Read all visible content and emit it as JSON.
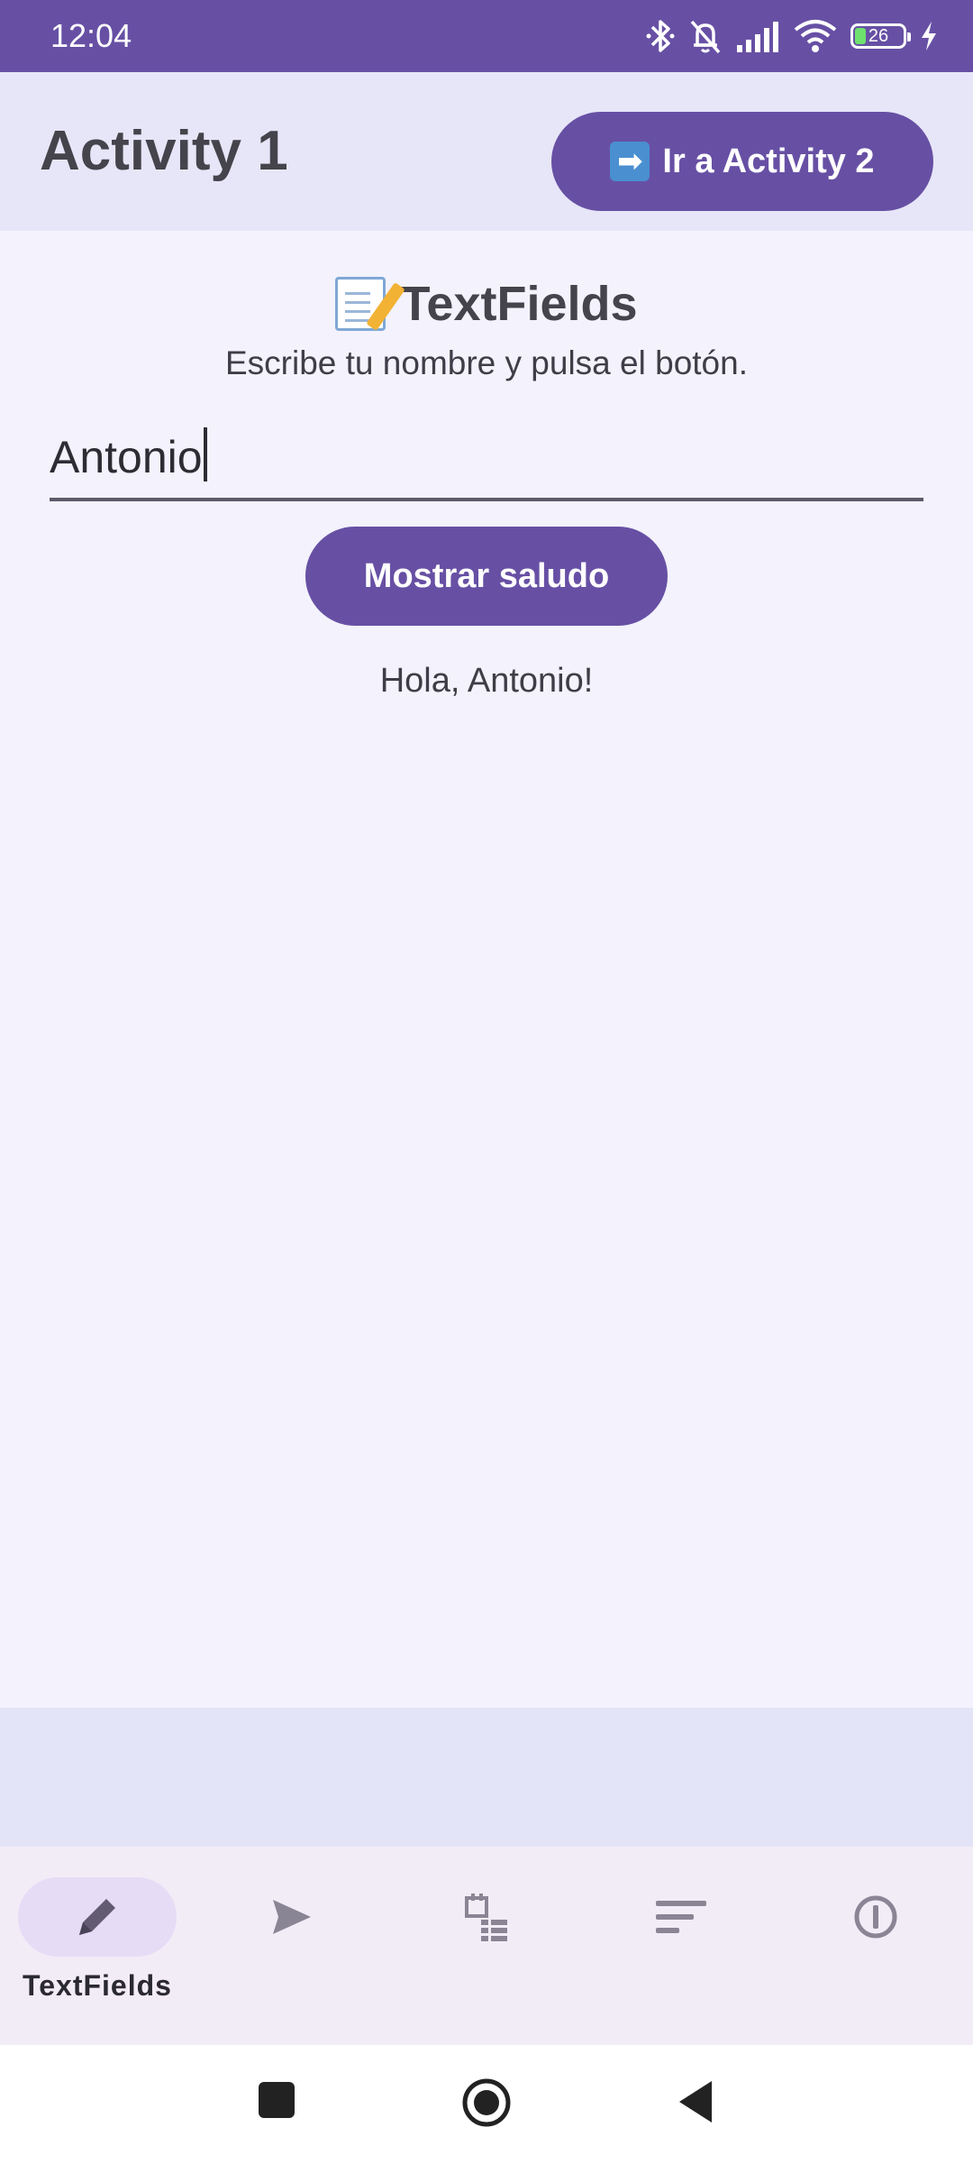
{
  "status_bar": {
    "time": "12:04",
    "battery_level": "26",
    "background_color": "#6750a4",
    "icons": [
      "bluetooth-icon",
      "bell-off-icon",
      "signal-icon",
      "wifi-icon",
      "battery-icon",
      "charging-icon"
    ]
  },
  "top_bar": {
    "title": "Activity 1",
    "go_button_icon": "➡",
    "go_button_label": "Ir a Activity 2"
  },
  "main": {
    "section_title": "TextFields",
    "section_icon": "memo-icon",
    "subtitle": "Escribe tu nombre y pulsa el botón.",
    "name_field_value": "Antonio",
    "greet_button_label": "Mostrar saludo",
    "greeting_text": "Hola, Antonio!"
  },
  "bottom_nav": {
    "items": [
      {
        "icon": "pencil-icon",
        "label": "TextFields",
        "selected": true
      },
      {
        "icon": "send-icon",
        "label": "",
        "selected": false
      },
      {
        "icon": "calendar-list-icon",
        "label": "",
        "selected": false
      },
      {
        "icon": "sort-lines-icon",
        "label": "",
        "selected": false
      },
      {
        "icon": "info-icon",
        "label": "",
        "selected": false
      }
    ]
  },
  "system_nav": {
    "icons": [
      "recents-square-icon",
      "home-circle-icon",
      "back-triangle-icon"
    ]
  },
  "colors": {
    "primary": "#6750a4",
    "background": "#f3f2fd",
    "top_bar": "#e7e6f8",
    "nav_bar": "#f2ecf7",
    "nav_active_pill": "#e6dcf6"
  }
}
